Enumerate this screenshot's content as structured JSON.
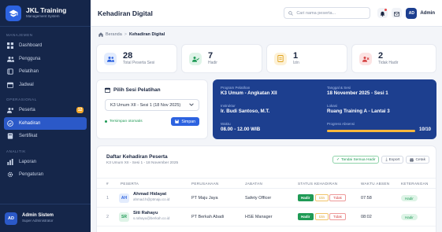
{
  "app": {
    "title": "JKL Training",
    "subtitle": "Management System"
  },
  "sidebar": {
    "sections": [
      {
        "label": "MANAJEMEN",
        "items": [
          {
            "label": "Dashboard",
            "icon": "grid-icon"
          },
          {
            "label": "Pengguna",
            "icon": "users-icon"
          },
          {
            "label": "Pelatihan",
            "icon": "book-icon"
          },
          {
            "label": "Jadwal",
            "icon": "calendar-icon"
          }
        ]
      },
      {
        "label": "OPERASIONAL",
        "items": [
          {
            "label": "Peserta",
            "icon": "users-icon",
            "badge": "12"
          },
          {
            "label": "Kehadiran",
            "icon": "check-circle-icon",
            "active": true
          },
          {
            "label": "Sertifikat",
            "icon": "certificate-icon"
          }
        ]
      },
      {
        "label": "ANALITIK",
        "items": [
          {
            "label": "Laporan",
            "icon": "bar-chart-icon"
          },
          {
            "label": "Pengaturan",
            "icon": "gear-icon"
          }
        ]
      }
    ],
    "user": {
      "initials": "AD",
      "name": "Admin Sistem",
      "role": "Super Administrator"
    }
  },
  "topbar": {
    "title": "Kehadiran Digital",
    "search_placeholder": "Cari nama peserta...",
    "avatar_initials": "AD",
    "user_name": "Admin"
  },
  "breadcrumb": {
    "home": "Beranda",
    "separator": ">",
    "current": "Kehadiran Digital"
  },
  "stats": [
    {
      "value": "28",
      "label": "Total Peserta Sesi",
      "icon": "users-icon",
      "color": "#2d63e0",
      "bg": "#e3ecfd"
    },
    {
      "value": "7",
      "label": "Hadir",
      "icon": "user-check-icon",
      "color": "#1f9a55",
      "bg": "#dff4e8"
    },
    {
      "value": "1",
      "label": "Izin",
      "icon": "document-icon",
      "color": "#e0a21d",
      "bg": "#fdf1d6"
    },
    {
      "value": "2",
      "label": "Tidak Hadir",
      "icon": "user-x-icon",
      "color": "#d64545",
      "bg": "#fce3e3"
    }
  ],
  "session": {
    "title": "Pilih Sesi Pelatihan",
    "selected": "K3 Umum XII - Sesi 1 (18 Nov 2025)",
    "saved_text": "Tersimpan otomatis",
    "save_label": "Simpan"
  },
  "info": {
    "program_label": "Program Pelatihan",
    "program_value": "K3 Umum - Angkatan XII",
    "date_label": "Tanggal & Sesi",
    "date_value": "18 November 2025 - Sesi 1",
    "instructor_label": "Instruktur",
    "instructor_value": "Ir. Budi Santoso, M.T.",
    "location_label": "Lokasi",
    "location_value": "Ruang Training A - Lantai 3",
    "time_label": "Waktu",
    "time_value": "08.00 - 12.00 WIB",
    "progress_label": "Progress Absensi",
    "progress_value": "10/10",
    "progress_fraction": 1.0
  },
  "table": {
    "title": "Daftar Kehadiran Peserta",
    "subtitle": "K3 Umum XII - Sesi 1 - 18 November 2025",
    "buttons": {
      "mark_all": "Tandai Semua Hadir",
      "export": "Export",
      "print": "Cetak"
    },
    "columns": [
      "#",
      "PESERTA",
      "PERUSAHAAN",
      "JABATAN",
      "STATUS KEHADIRAN",
      "WAKTU ABSEN",
      "KETERANGAN"
    ],
    "rows": [
      {
        "no": "1",
        "initials": "AH",
        "name": "Ahmad Hidayat",
        "email": "ahmad.h@ptmaju.co.id",
        "company": "PT Maju Jaya",
        "position": "Safety Officer",
        "status": {
          "hadir": "Hadir",
          "izin": "Izin",
          "tidak": "Tidak"
        },
        "time": "07:58",
        "note": "Hadir",
        "av_bg": "#e3ecfd",
        "av_color": "#2d63e0"
      },
      {
        "no": "2",
        "initials": "SR",
        "name": "Siti Rahayu",
        "email": "s.rahayu@berkah.co.id",
        "company": "PT Berkah Abadi",
        "position": "HSE Manager",
        "status": {
          "hadir": "Hadir",
          "izin": "Izin",
          "tidak": "Tidak"
        },
        "time": "08:02",
        "note": "Hadir",
        "av_bg": "#dff4e8",
        "av_color": "#1f9a55"
      }
    ]
  }
}
